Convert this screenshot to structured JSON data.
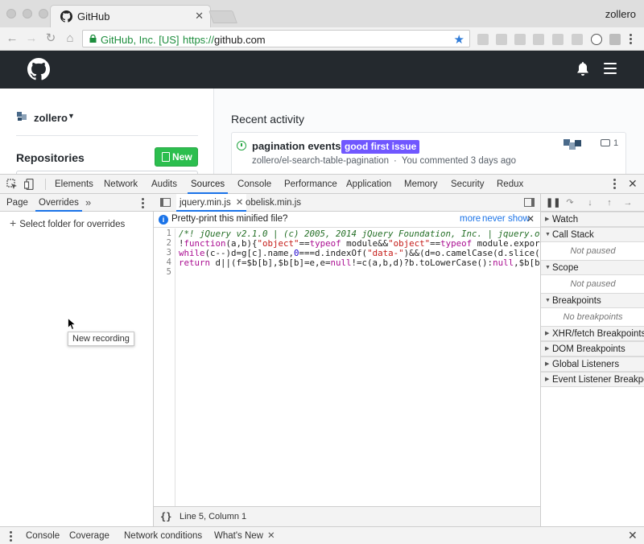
{
  "browser": {
    "tab_title": "GitHub",
    "tab_close": "✕",
    "profile_name": "zollero",
    "nav_icons": [
      "back-icon",
      "forward-icon",
      "reload-icon",
      "home-icon"
    ],
    "omnibox": {
      "secure_label": "GitHub, Inc. [US]",
      "url_scheme": "https://",
      "url_host": "github.com"
    },
    "star": "★"
  },
  "github": {
    "username": "zollero",
    "repositories_title": "Repositories",
    "new_button": "New",
    "recent_activity_title": "Recent activity",
    "activity": {
      "title": "pagination events",
      "label": "good first issue",
      "label_color": "#7057ff",
      "repo": "zollero/el-search-table-pagination",
      "meta": "You commented 3 days ago",
      "comments": "1"
    }
  },
  "devtools": {
    "tabs": [
      "Elements",
      "Network",
      "Audits",
      "Sources",
      "Console",
      "Performance",
      "Application",
      "Memory",
      "Security",
      "Redux"
    ],
    "active_tab": "Sources",
    "navigator": {
      "tabs": [
        "Page",
        "Overrides"
      ],
      "more": "»",
      "select_folder": "Select folder for overrides",
      "tooltip": "New recording"
    },
    "editor": {
      "files": [
        "jquery.min.js",
        "obelisk.min.js"
      ],
      "infobar": {
        "text": "Pretty-print this minified file?",
        "more": "more",
        "never_show": "never show"
      },
      "line_numbers": [
        "1",
        "2",
        "3",
        "4",
        "5"
      ],
      "status": "Line 5, Column 1",
      "braces": "{}"
    },
    "debugger": {
      "panes": [
        {
          "title": "Watch",
          "body": ""
        },
        {
          "title": "Call Stack",
          "body": "Not paused"
        },
        {
          "title": "Scope",
          "body": "Not paused"
        },
        {
          "title": "Breakpoints",
          "body": "No breakpoints"
        },
        {
          "title": "XHR/fetch Breakpoints",
          "body": ""
        },
        {
          "title": "DOM Breakpoints",
          "body": ""
        },
        {
          "title": "Global Listeners",
          "body": ""
        },
        {
          "title": "Event Listener Breakpoints",
          "body": ""
        }
      ]
    },
    "drawer": {
      "tabs": [
        "Console",
        "Coverage",
        "Network conditions",
        "What's New"
      ],
      "active_tab": "What's New"
    }
  }
}
